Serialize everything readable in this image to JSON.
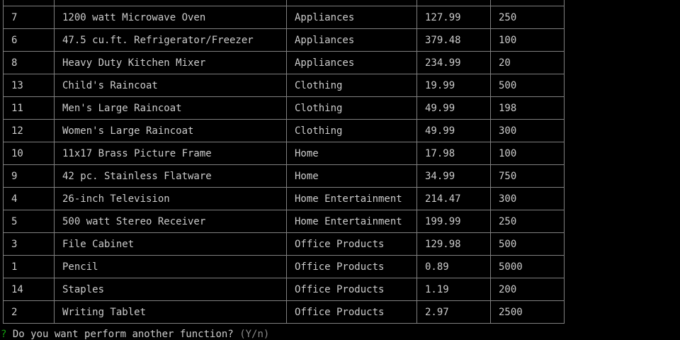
{
  "table": {
    "rows": [
      [
        "",
        "",
        "",
        "",
        ""
      ],
      [
        "7",
        "1200 watt Microwave Oven",
        "Appliances",
        "127.99",
        "250"
      ],
      [
        "6",
        "47.5 cu.ft. Refrigerator/Freezer",
        "Appliances",
        "379.48",
        "100"
      ],
      [
        "8",
        "Heavy Duty Kitchen Mixer",
        "Appliances",
        "234.99",
        "20"
      ],
      [
        "13",
        "Child's Raincoat",
        "Clothing",
        "19.99",
        "500"
      ],
      [
        "11",
        "Men's Large Raincoat",
        "Clothing",
        "49.99",
        "198"
      ],
      [
        "12",
        "Women's Large Raincoat",
        "Clothing",
        "49.99",
        "300"
      ],
      [
        "10",
        "11x17 Brass Picture Frame",
        "Home",
        "17.98",
        "100"
      ],
      [
        "9",
        "42 pc. Stainless Flatware",
        "Home",
        "34.99",
        "750"
      ],
      [
        "4",
        "26-inch Television",
        "Home Entertainment",
        "214.47",
        "300"
      ],
      [
        "5",
        "500 watt Stereo Receiver",
        "Home Entertainment",
        "199.99",
        "250"
      ],
      [
        "3",
        "File Cabinet",
        "Office Products",
        "129.98",
        "500"
      ],
      [
        "1",
        "Pencil",
        "Office Products",
        "0.89",
        "5000"
      ],
      [
        "14",
        "Staples",
        "Office Products",
        "1.19",
        "200"
      ],
      [
        "2",
        "Writing Tablet",
        "Office Products",
        "2.97",
        "2500"
      ]
    ]
  },
  "prompt": {
    "marker": "?",
    "question": "Do you want perform another function?",
    "hint": "(Y/n)"
  },
  "colors": {
    "background": "#000000",
    "text": "#cccccc",
    "border": "#808080",
    "prompt_marker": "#13a10e",
    "hint": "#8a8a8a"
  }
}
